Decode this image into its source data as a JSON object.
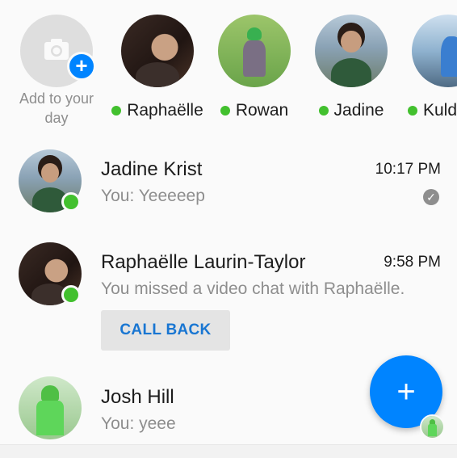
{
  "stories": {
    "add": {
      "label": "Add to your day",
      "icon": "camera-icon"
    },
    "items": [
      {
        "name": "Raphaëlle",
        "online": true
      },
      {
        "name": "Rowan",
        "online": true
      },
      {
        "name": "Jadine",
        "online": true
      },
      {
        "name": "Kuld",
        "online": true
      }
    ]
  },
  "conversations": [
    {
      "name": "Jadine Krist",
      "time": "10:17 PM",
      "snippet": "You: Yeeeeep",
      "online": true,
      "seen": true
    },
    {
      "name": "Raphaëlle Laurin-Taylor",
      "time": "9:58 PM",
      "snippet": "You missed a video chat with Raphaëlle.",
      "online": true,
      "action": "CALL BACK"
    },
    {
      "name": "Josh Hill",
      "time": "",
      "snippet": "You: yeee",
      "online": false
    }
  ],
  "fab": {
    "label": "+"
  },
  "colors": {
    "accent": "#0084ff",
    "online": "#42c02e",
    "callback_text": "#1976d2"
  }
}
